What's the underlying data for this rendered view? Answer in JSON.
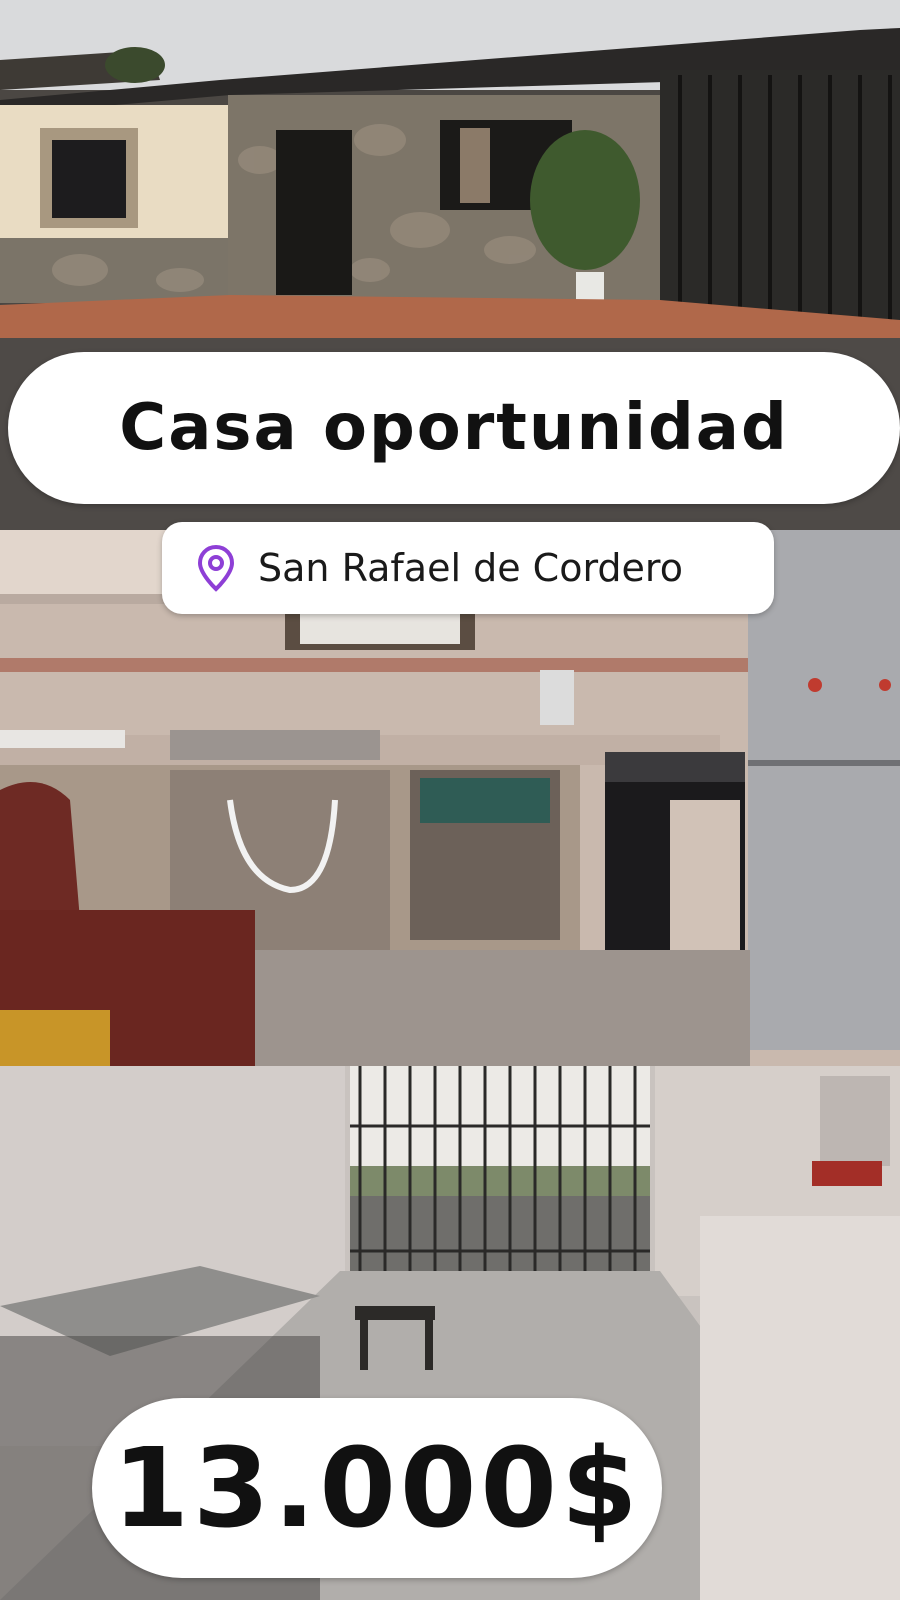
{
  "title": "Casa oportunidad",
  "location": {
    "icon": "map-pin-icon",
    "text": "San Rafael de Cordero",
    "icon_color": "#8e3fd6"
  },
  "price": "13.000$",
  "photos": [
    "house-exterior-photo",
    "kitchen-photo",
    "living-room-photo"
  ]
}
